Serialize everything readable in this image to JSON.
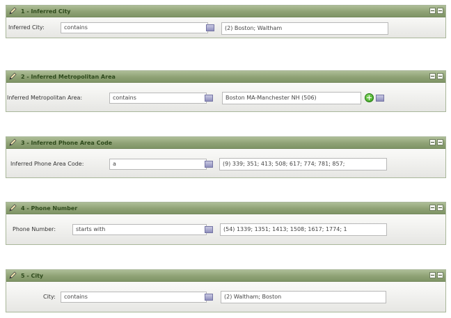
{
  "panels": [
    {
      "title": "1 - Inferred City",
      "field_label": "Inferred City:",
      "operator": "contains",
      "value": "(2) Boston; Waltham"
    },
    {
      "title": "2 - Inferred Metropolitan Area",
      "field_label": "Inferred Metropolitan Area:",
      "operator": "contains",
      "value": "Boston MA-Manchester NH (506)"
    },
    {
      "title": "3 - Inferred Phone Area Code",
      "field_label": "Inferred Phone Area Code:",
      "operator": "a",
      "value": "(9) 339; 351; 413; 508; 617; 774; 781; 857;"
    },
    {
      "title": "4 - Phone Number",
      "field_label": "Phone Number:",
      "operator": "starts with",
      "value": "(54) 1339; 1351; 1413; 1508; 1617; 1774; 1"
    },
    {
      "title": "5 - City",
      "field_label": "City:",
      "operator": "contains",
      "value": "(2) Waltham; Boston"
    }
  ],
  "icons": {
    "edit": "pencil-icon",
    "minimize": "minimize-icon",
    "close": "close-icon",
    "lookup": "lookup-icon",
    "add": "add-icon"
  },
  "colors": {
    "header": "#8fa275",
    "title_text": "#2e4a1c",
    "lookup": "#8f8fbd",
    "add": "#2e9a14"
  }
}
